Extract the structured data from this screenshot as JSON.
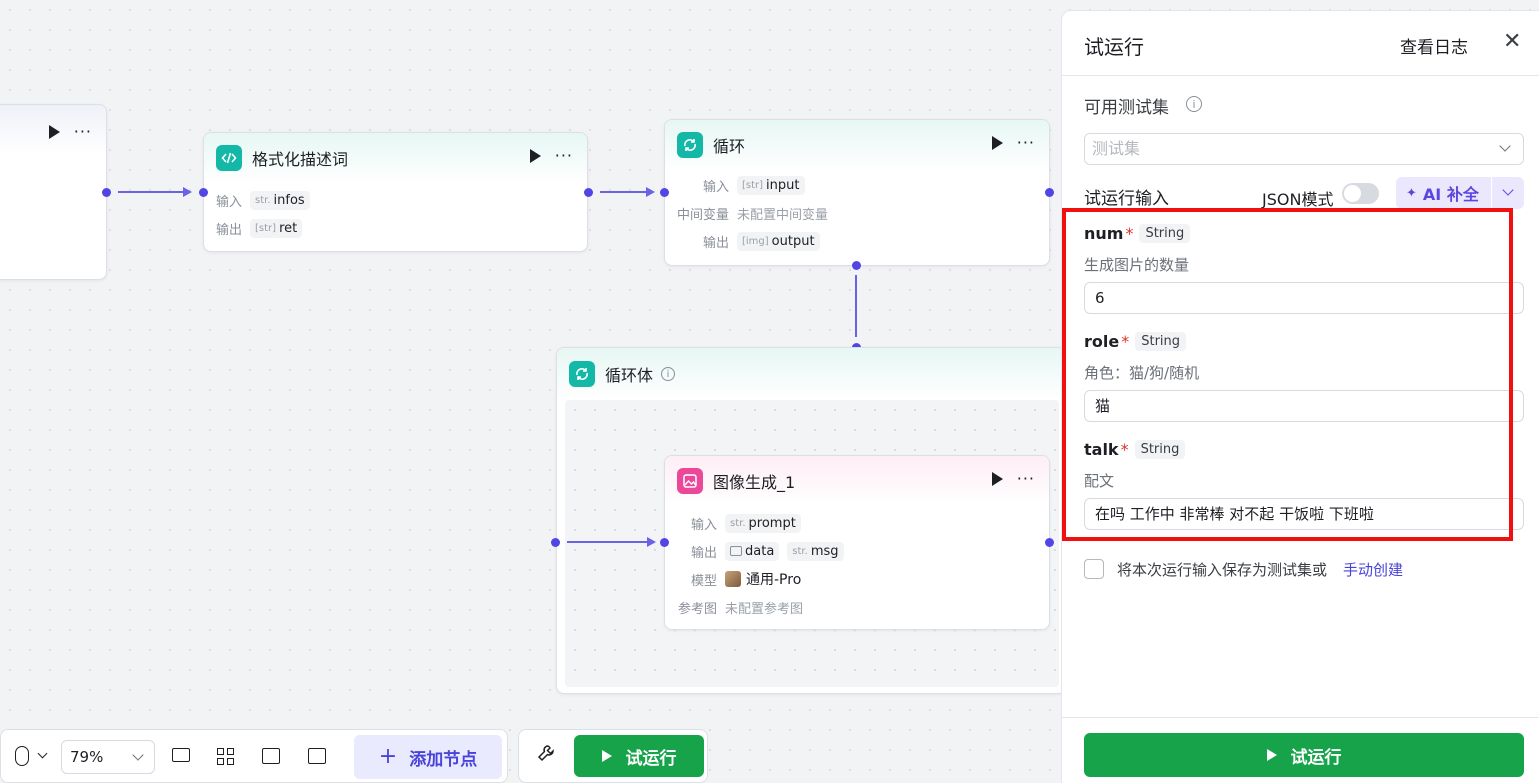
{
  "colors": {
    "accent": "#5146e5",
    "run_green": "#16a34a",
    "teal": "#14b8a6",
    "pink": "#ec4899",
    "highlight": "#f01010"
  },
  "nodes": {
    "format": {
      "title": "格式化描述词",
      "input_label": "输入",
      "input_type": "str.",
      "input_value": "infos",
      "output_label": "输出",
      "output_type": "[str]",
      "output_value": "ret",
      "icon": "code-icon"
    },
    "loop": {
      "title": "循环",
      "input_label": "输入",
      "input_type": "[str]",
      "input_value": "input",
      "var_label": "中间变量",
      "var_value": "未配置中间变量",
      "output_label": "输出",
      "output_type": "[img]",
      "output_value": "output",
      "icon": "loop-icon"
    },
    "loop_body": {
      "title": "循环体",
      "icon": "loop-icon"
    },
    "image_gen": {
      "title": "图像生成_1",
      "input_label": "输入",
      "input_type": "str.",
      "input_value": "prompt",
      "output_label": "输出",
      "output_tag1": "data",
      "output_type2": "str.",
      "output_tag2": "msg",
      "model_label": "模型",
      "model_value": "通用-Pro",
      "ref_label": "参考图",
      "ref_value": "未配置参考图",
      "icon": "image-icon"
    }
  },
  "toolbar": {
    "zoom": "79%",
    "add_node": "添加节点",
    "run": "试运行"
  },
  "panel": {
    "title": "试运行",
    "log_link": "查看日志",
    "testset_label": "可用测试集",
    "testset_placeholder": "测试集",
    "input_label": "试运行输入",
    "json_mode": "JSON模式",
    "ai_fill": "AI 补全",
    "fields": [
      {
        "name": "num",
        "type": "String",
        "desc": "生成图片的数量",
        "value": "6"
      },
      {
        "name": "role",
        "type": "String",
        "desc": "角色：猫/狗/随机",
        "value": "猫"
      },
      {
        "name": "talk",
        "type": "String",
        "desc": "配文",
        "value": "在吗 工作中 非常棒 对不起 干饭啦 下班啦"
      }
    ],
    "save_text": "将本次运行输入保存为测试集或",
    "save_link": "手动创建",
    "run_button": "试运行"
  }
}
